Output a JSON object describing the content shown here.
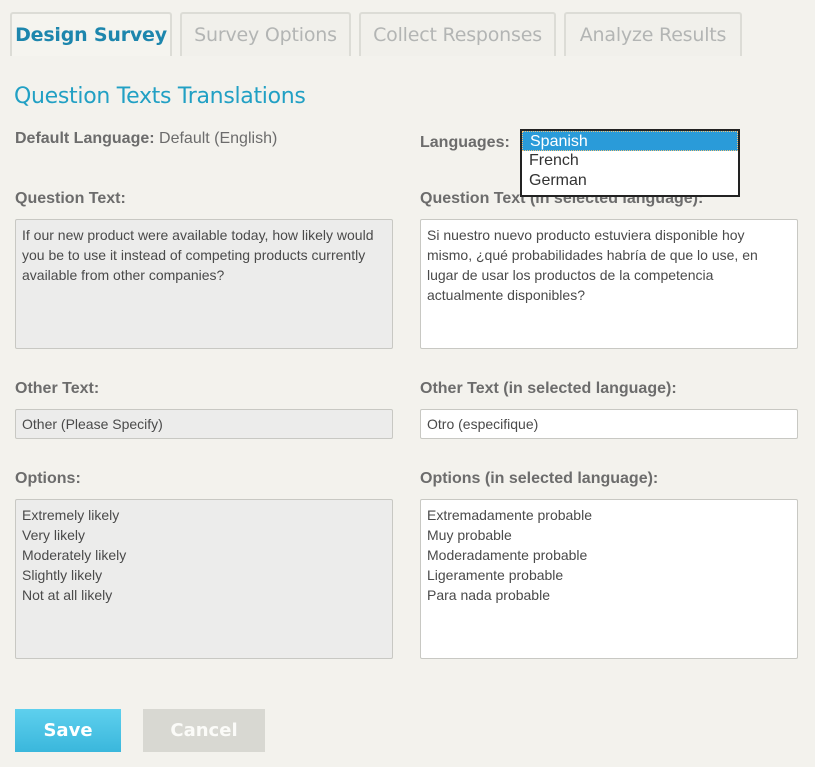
{
  "tabs": [
    {
      "label": "Design Survey",
      "active": true
    },
    {
      "label": "Survey Options",
      "active": false
    },
    {
      "label": "Collect Responses",
      "active": false
    },
    {
      "label": "Analyze Results",
      "active": false
    }
  ],
  "section_title": "Question Texts Translations",
  "default_language": {
    "label": "Default Language:",
    "value": "Default (English)"
  },
  "languages": {
    "label": "Languages:",
    "options": [
      "Spanish",
      "French",
      "German"
    ],
    "selected": "Spanish"
  },
  "question_text": {
    "label": "Question Text:",
    "lines": [
      "If our new product were available today, how likely would",
      "you be to use it instead of competing products currently",
      "available from other companies?"
    ]
  },
  "question_text_translated": {
    "label": "Question Text (in selected language):",
    "lines": [
      "Si nuestro nuevo producto estuviera disponible hoy",
      "mismo, ¿qué probabilidades habría de que lo use, en",
      "lugar de usar los productos de la competencia",
      "actualmente disponibles?"
    ]
  },
  "other_text": {
    "label": "Other Text:",
    "value": "Other (Please Specify)"
  },
  "other_text_translated": {
    "label": "Other Text (in selected language):",
    "value": "Otro (especifique)"
  },
  "options": {
    "label": "Options:",
    "lines": [
      "Extremely likely",
      "Very likely",
      "Moderately likely",
      "Slightly likely",
      "Not at all likely"
    ]
  },
  "options_translated": {
    "label": "Options (in selected language):",
    "lines": [
      "Extremadamente probable",
      "Muy probable",
      "Moderadamente probable",
      "Ligeramente probable",
      "Para nada probable"
    ]
  },
  "buttons": {
    "save": "Save",
    "cancel": "Cancel"
  }
}
